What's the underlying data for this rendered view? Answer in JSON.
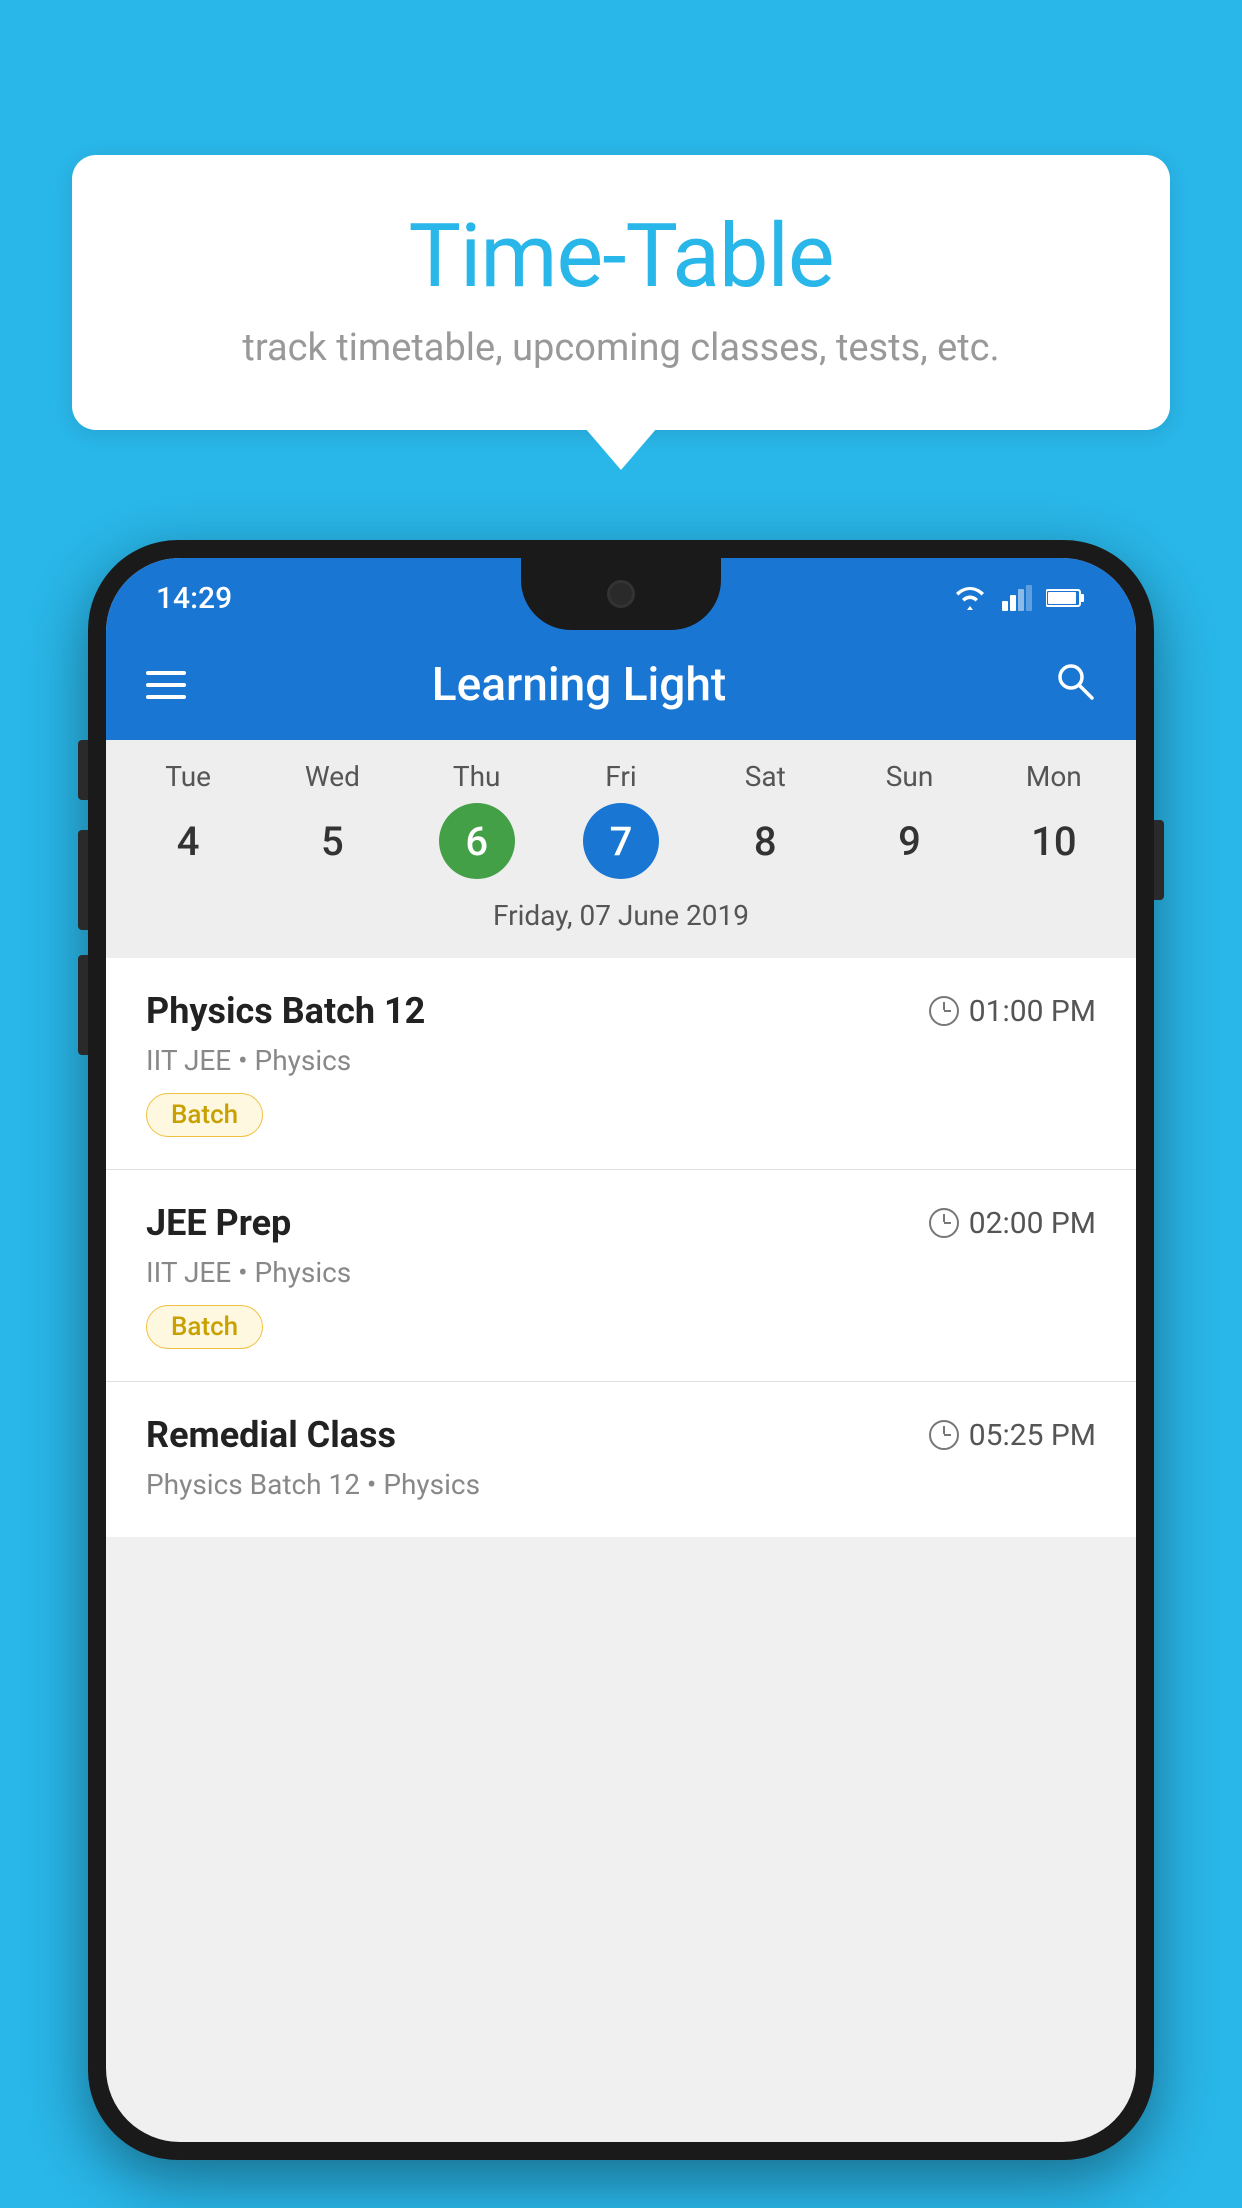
{
  "background_color": "#29b6e8",
  "tooltip": {
    "title": "Time-Table",
    "subtitle": "track timetable, upcoming classes, tests, etc."
  },
  "phone": {
    "status_bar": {
      "time": "14:29"
    },
    "app_bar": {
      "title": "Learning Light"
    },
    "calendar": {
      "days": [
        {
          "label": "Tue",
          "num": "4"
        },
        {
          "label": "Wed",
          "num": "5"
        },
        {
          "label": "Thu",
          "num": "6",
          "state": "today"
        },
        {
          "label": "Fri",
          "num": "7",
          "state": "selected"
        },
        {
          "label": "Sat",
          "num": "8"
        },
        {
          "label": "Sun",
          "num": "9"
        },
        {
          "label": "Mon",
          "num": "10"
        }
      ],
      "selected_date": "Friday, 07 June 2019"
    },
    "schedule": [
      {
        "title": "Physics Batch 12",
        "time": "01:00 PM",
        "subtitle": "IIT JEE • Physics",
        "badge": "Batch"
      },
      {
        "title": "JEE Prep",
        "time": "02:00 PM",
        "subtitle": "IIT JEE • Physics",
        "badge": "Batch"
      },
      {
        "title": "Remedial Class",
        "time": "05:25 PM",
        "subtitle": "Physics Batch 12 • Physics",
        "badge": null
      }
    ]
  }
}
